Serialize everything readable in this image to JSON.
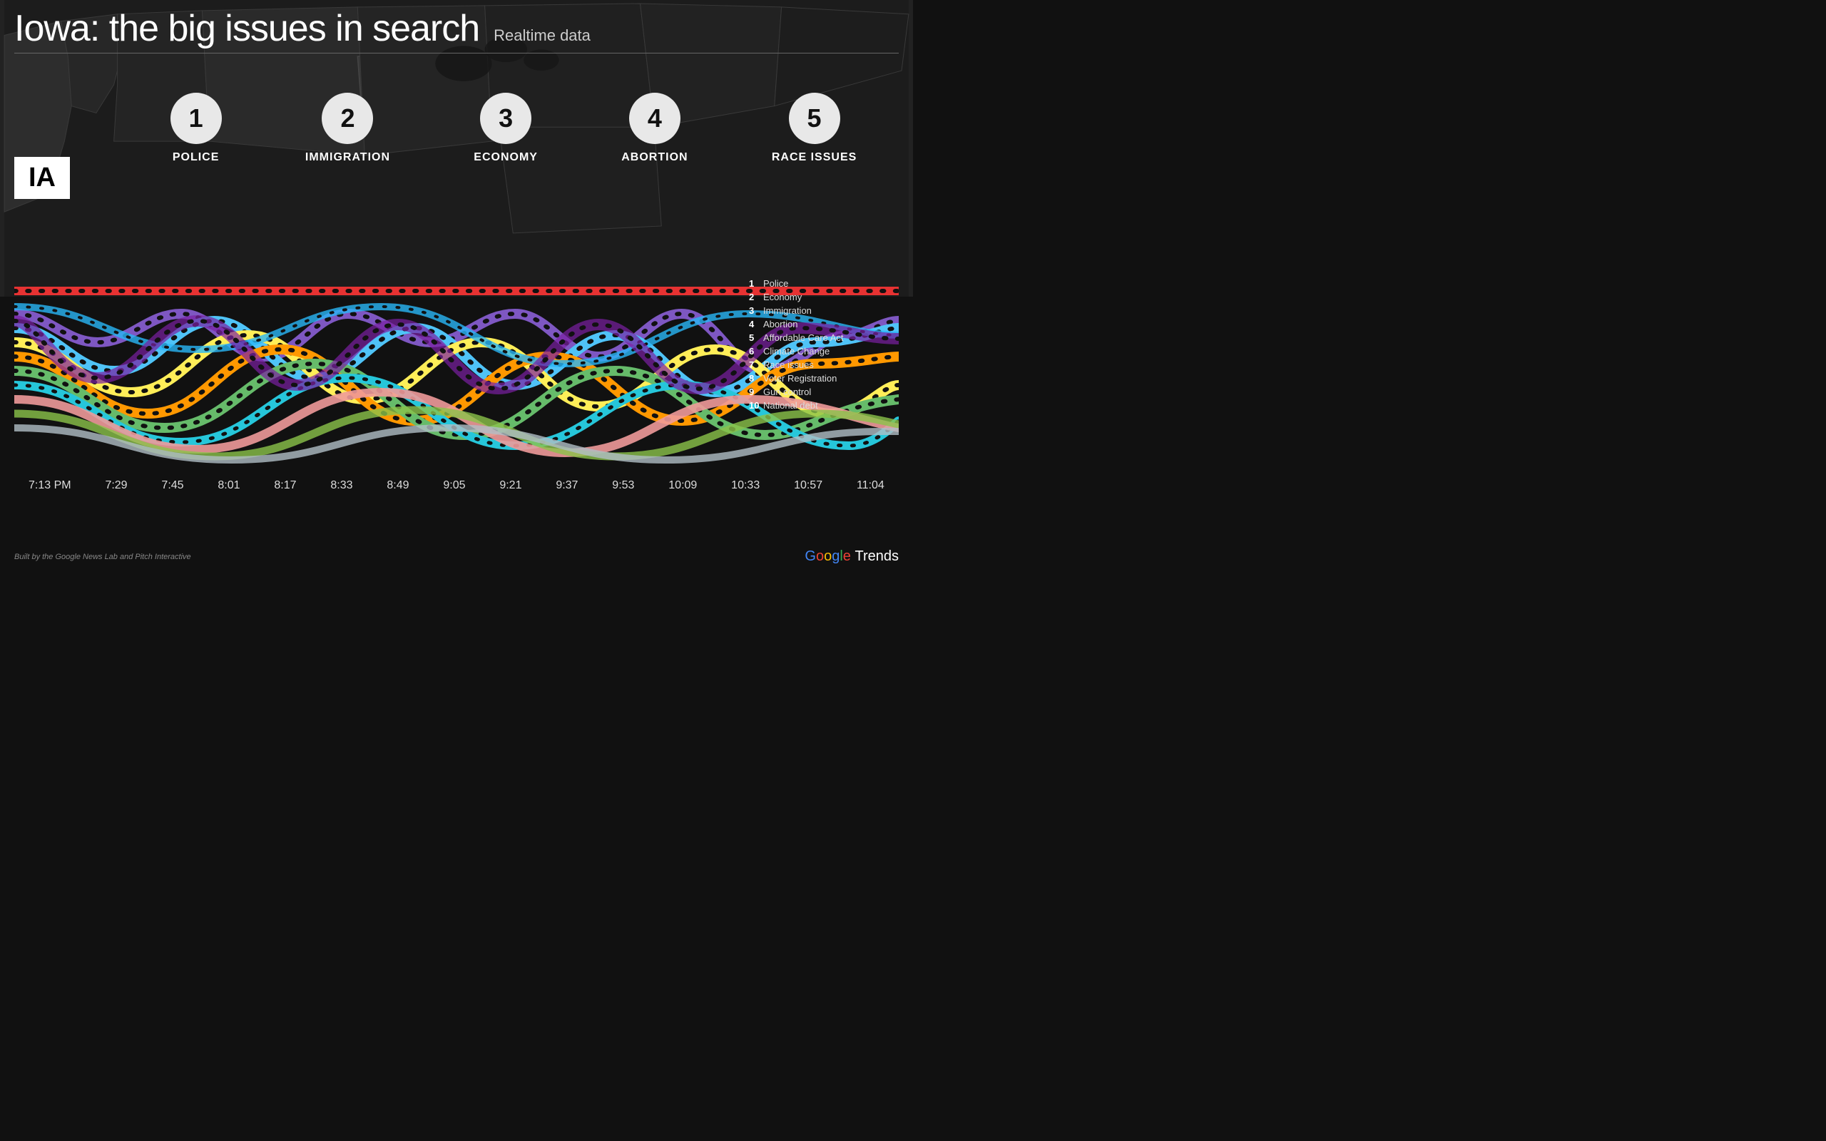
{
  "header": {
    "main_title": "Iowa: the big issues in search",
    "subtitle": "Realtime data"
  },
  "state": {
    "abbr": "IA"
  },
  "rankings": [
    {
      "rank": "1",
      "label": "POLICE"
    },
    {
      "rank": "2",
      "label": "IMMIGRATION"
    },
    {
      "rank": "3",
      "label": "ECONOMY"
    },
    {
      "rank": "4",
      "label": "ABORTION"
    },
    {
      "rank": "5",
      "label": "RACE ISSUES"
    }
  ],
  "legend": [
    {
      "num": "1",
      "label": "Police",
      "color": "#e63232"
    },
    {
      "num": "2",
      "label": "Economy",
      "color": "#4fc3f7"
    },
    {
      "num": "3",
      "label": "Immigration",
      "color": "#81c784"
    },
    {
      "num": "4",
      "label": "Abortion",
      "color": "#ff9800"
    },
    {
      "num": "5",
      "label": "Affordable Care Act",
      "color": "#ffee58"
    },
    {
      "num": "6",
      "label": "Climate Change",
      "color": "#26c6da"
    },
    {
      "num": "7",
      "label": "Race issues",
      "color": "#7e57c2"
    },
    {
      "num": "8",
      "label": "Voter Registration",
      "color": "#ef9a9a"
    },
    {
      "num": "9",
      "label": "Gun control",
      "color": "#a5d6a7"
    },
    {
      "num": "10",
      "label": "National debt",
      "color": "#b0bec5"
    }
  ],
  "timeline": {
    "labels": [
      "7:13 PM",
      "7:29",
      "7:45",
      "8:01",
      "8:17",
      "8:33",
      "8:49",
      "9:05",
      "9:21",
      "9:37",
      "9:53",
      "10:09",
      "10:33",
      "10:57",
      "11:04"
    ]
  },
  "footer": {
    "credit": "Built by the Google News Lab and Pitch Interactive",
    "brand": "Google Trends"
  }
}
